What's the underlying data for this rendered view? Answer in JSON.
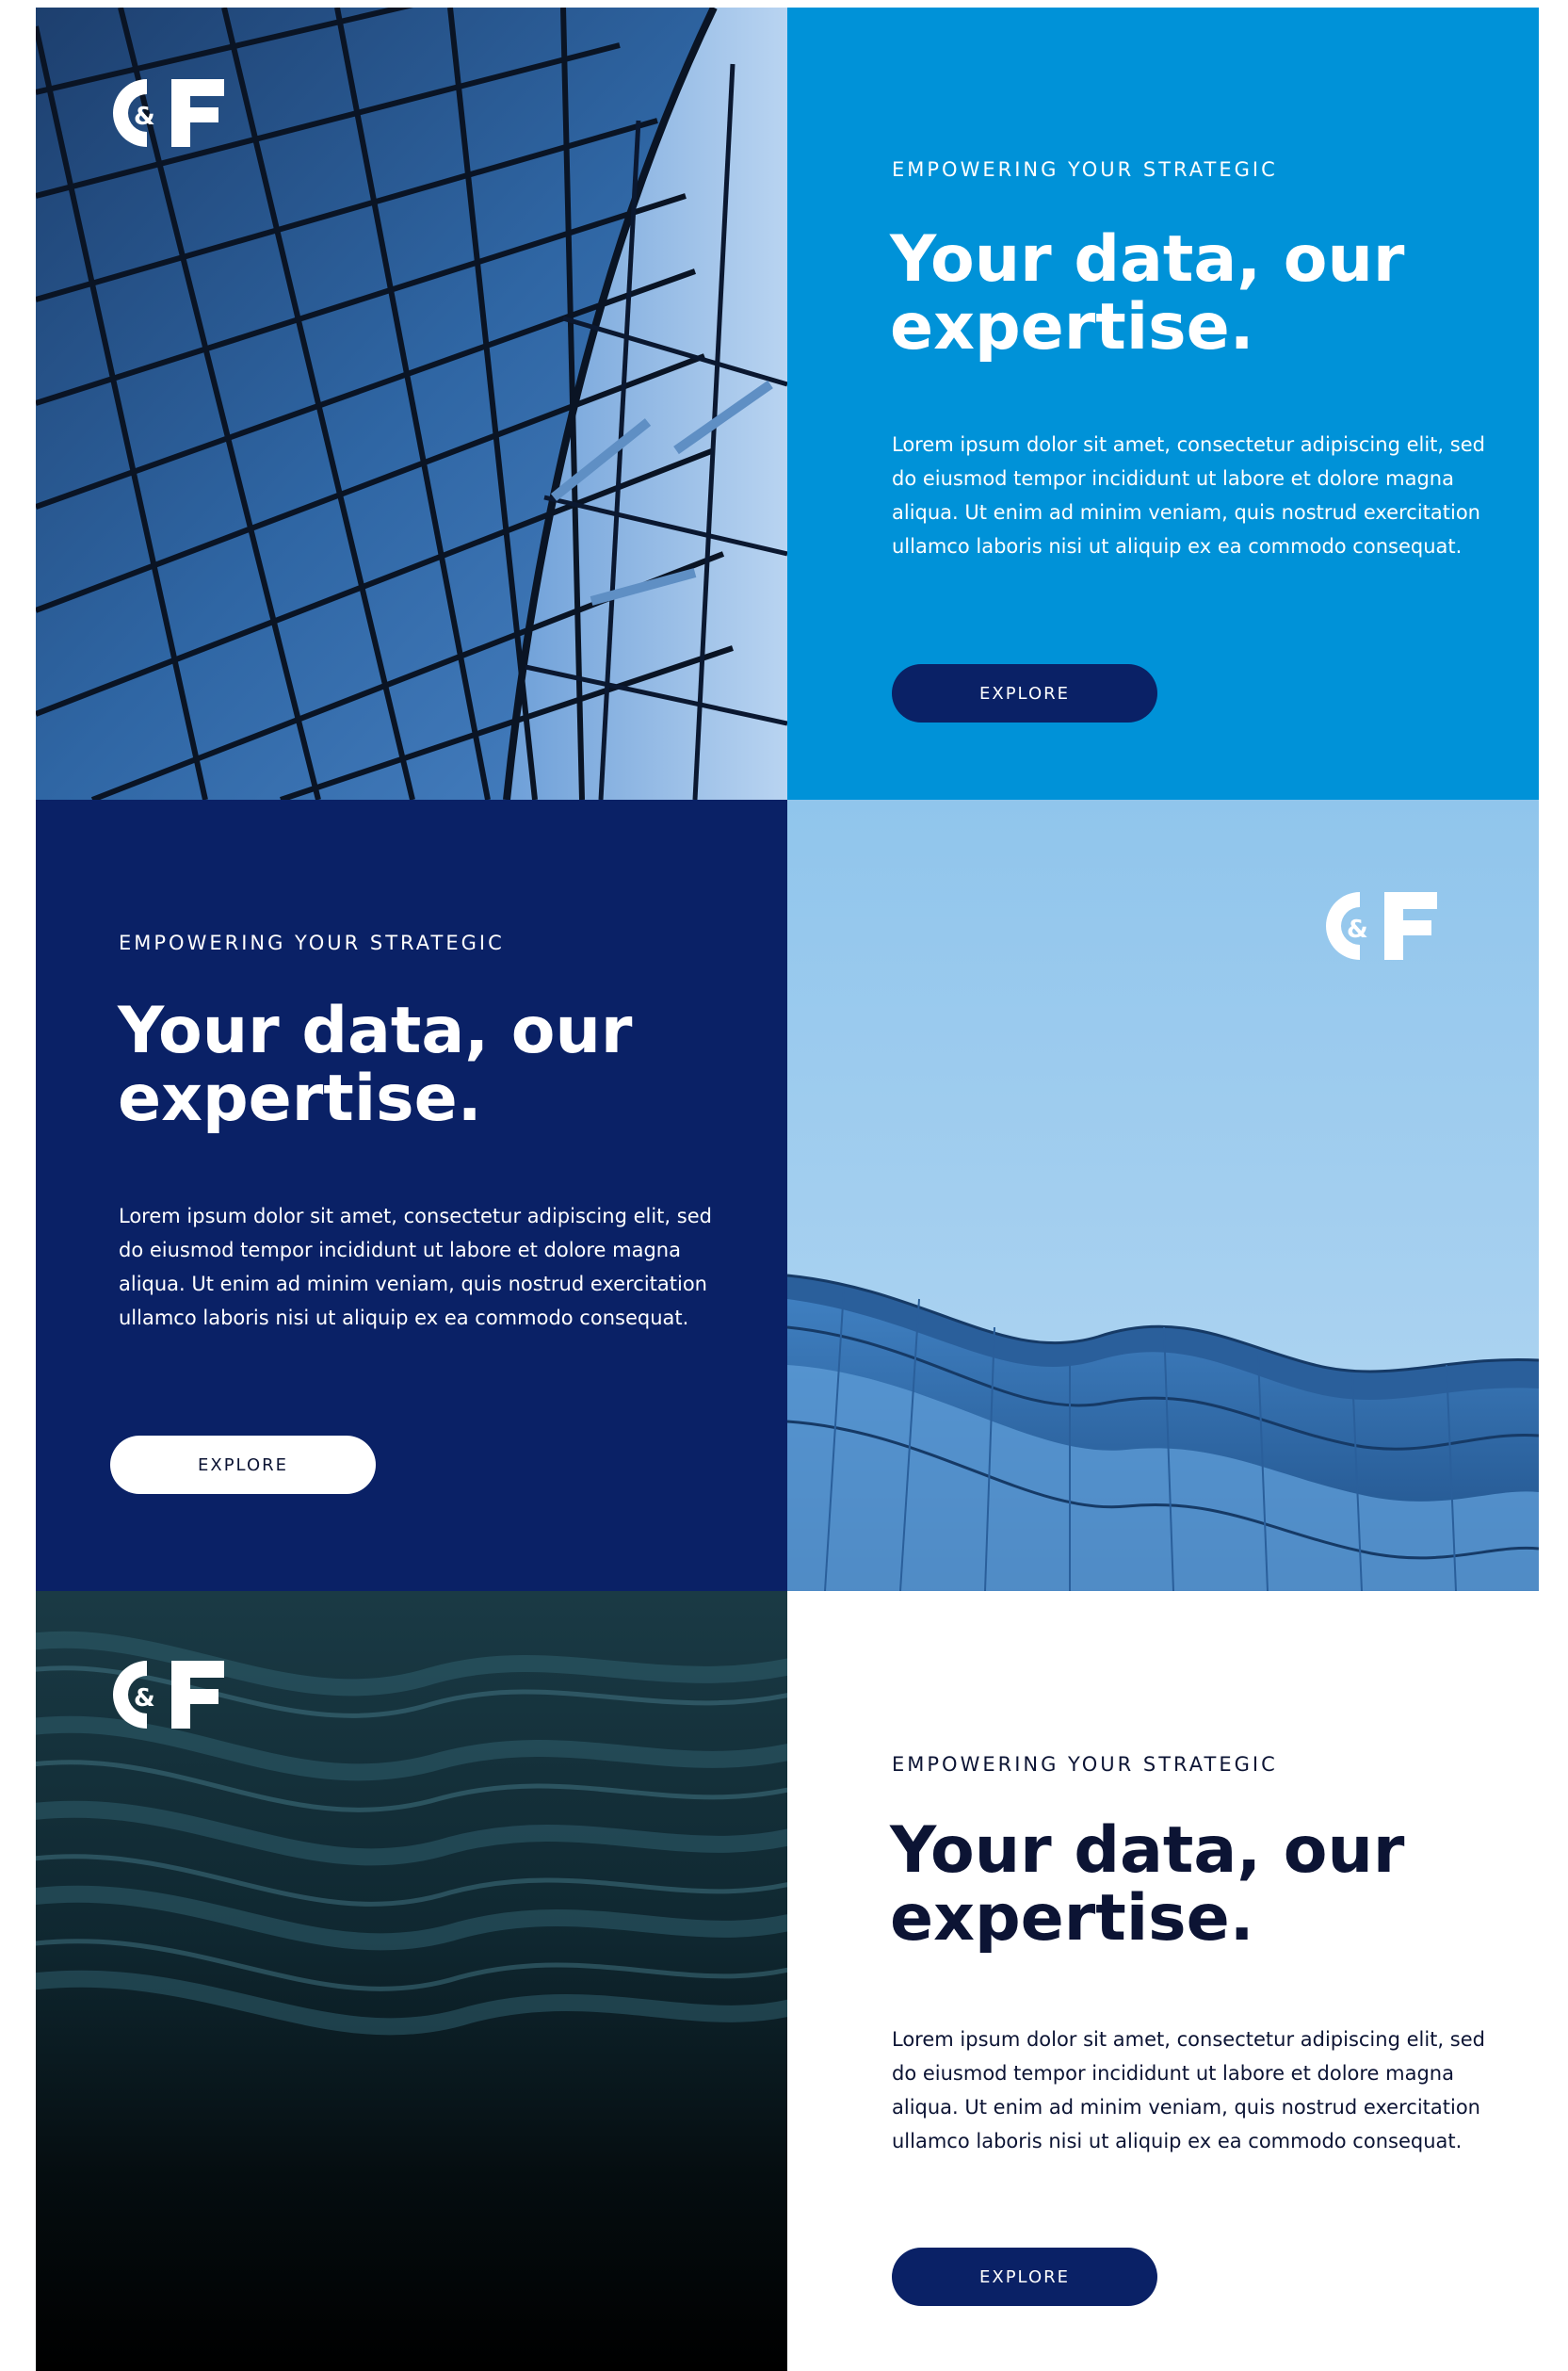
{
  "brand": {
    "logo_text": "C&F"
  },
  "sections": [
    {
      "eyebrow": "EMPOWERING YOUR STRATEGIC",
      "headline_line1": "Your data, our",
      "headline_line2": "expertise.",
      "body": "Lorem ipsum dolor sit amet, consectetur adipiscing elit, sed do eiusmod tempor incididunt ut labore et dolore magna aliqua. Ut enim ad minim veniam, quis nostrud exercitation ullamco laboris nisi ut aliquip ex ea commodo consequat.",
      "button_label": "EXPLORE",
      "panel_color": "#0092d8"
    },
    {
      "eyebrow": "EMPOWERING YOUR STRATEGIC",
      "headline_line1": "Your data, our",
      "headline_line2": "expertise.",
      "body": "Lorem ipsum dolor sit amet, consectetur adipiscing elit, sed do eiusmod tempor incididunt ut labore et dolore magna aliqua. Ut enim ad minim veniam, quis nostrud exercitation ullamco laboris nisi ut aliquip ex ea commodo consequat.",
      "button_label": "EXPLORE",
      "panel_color": "#0a2166"
    },
    {
      "eyebrow": "EMPOWERING YOUR STRATEGIC",
      "headline_line1": "Your data, our",
      "headline_line2": "expertise.",
      "body": "Lorem ipsum dolor sit amet, consectetur adipiscing elit, sed do eiusmod tempor incididunt ut labore et dolore magna aliqua. Ut enim ad minim veniam, quis nostrud exercitation ullamco laboris nisi ut aliquip ex ea commodo consequat.",
      "button_label": "EXPLORE",
      "panel_color": "#ffffff"
    }
  ],
  "images": [
    {
      "icon": "glass-roof-lattice-photo"
    },
    {
      "icon": "wavy-building-roof-photo"
    },
    {
      "icon": "dark-rope-texture-photo"
    }
  ],
  "colors": {
    "cyan": "#0092d8",
    "navy": "#0a2166",
    "dark_text": "#0c1434",
    "white": "#ffffff"
  }
}
